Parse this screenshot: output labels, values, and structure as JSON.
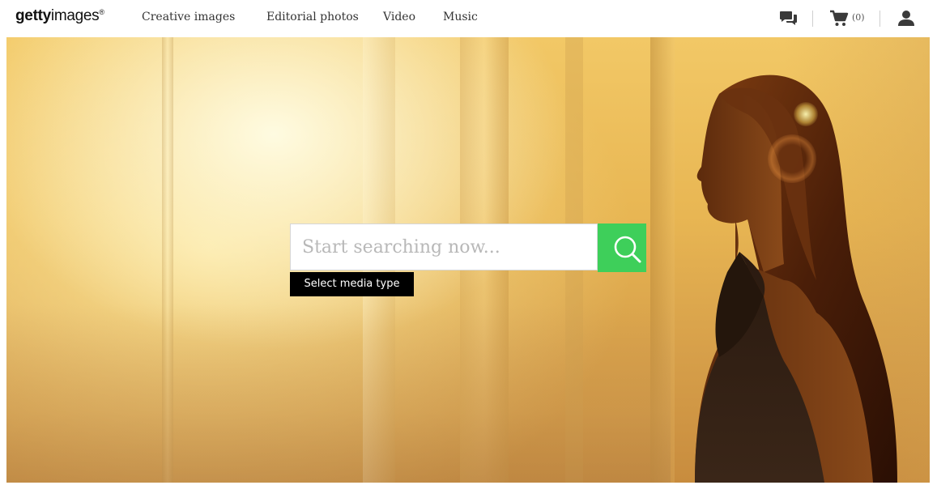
{
  "header": {
    "logo": {
      "bold": "getty",
      "regular": "images",
      "mark": "®"
    },
    "nav": [
      {
        "label": "Creative images"
      },
      {
        "label": "Editorial photos"
      },
      {
        "label": "Video"
      },
      {
        "label": "Music"
      }
    ],
    "utility": {
      "chat_icon": "chat-bubbles-icon",
      "cart_icon": "cart-icon",
      "cart_count": "(0)",
      "account_icon": "user-icon"
    }
  },
  "hero": {
    "search": {
      "placeholder": "Start searching now...",
      "value": "",
      "button_icon": "search-icon"
    },
    "media_type_label": "Select media type"
  },
  "colors": {
    "accent_green": "#3ecf5a",
    "media_button_bg": "#000000",
    "text_dark": "#333333"
  }
}
